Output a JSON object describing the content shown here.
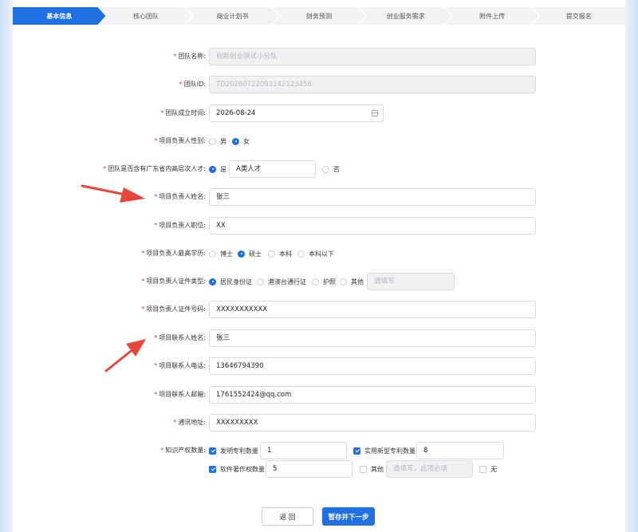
{
  "steps": [
    {
      "label": "基本信息",
      "active": true
    },
    {
      "label": "核心团队",
      "active": false
    },
    {
      "label": "商业计划书",
      "active": false
    },
    {
      "label": "财务预测",
      "active": false
    },
    {
      "label": "创业服务需求",
      "active": false
    },
    {
      "label": "附件上传",
      "active": false
    },
    {
      "label": "提交报名",
      "active": false
    }
  ],
  "required_mark": "*",
  "fields": {
    "team_name": {
      "label": "团队名称:",
      "value": "创新创业测试小分队"
    },
    "team_id": {
      "label": "团队ID:",
      "value": "TD20260722093142123456"
    },
    "founded": {
      "label": "团队成立时间:",
      "value": "2026-08-24"
    },
    "leader_gender": {
      "label": "项目负责人性别:",
      "options": [
        "男",
        "女"
      ],
      "selected": "女"
    },
    "talent": {
      "label": "团队是否含有广东省内高层次人才:",
      "options": [
        "是",
        "否"
      ],
      "selected": "是",
      "detail": "A类人才"
    },
    "leader_name": {
      "label": "项目负责人姓名:",
      "value": "张三"
    },
    "leader_title": {
      "label": "项目负责人职位:",
      "value": "XX"
    },
    "education": {
      "label": "项目负责人最高学历:",
      "options": [
        "博士",
        "硕士",
        "本科",
        "本科以下"
      ],
      "selected": "硕士"
    },
    "id_type": {
      "label": "项目负责人证件类型:",
      "options": [
        "居民身份证",
        "港澳台通行证",
        "护照",
        "其他"
      ],
      "selected": "居民身份证",
      "other_placeholder": "请填写"
    },
    "id_number": {
      "label": "项目负责人证件号码:",
      "value": "XXXXXXXXXXX"
    },
    "contact_name": {
      "label": "项目联系人姓名:",
      "value": "张三"
    },
    "contact_phone": {
      "label": "项目联系人电话:",
      "value": "13646794390"
    },
    "contact_email": {
      "label": "项目联系人邮箱:",
      "value": "1761552424@qq.com"
    },
    "address": {
      "label": "通讯地址:",
      "value": "XXXXXXXXX"
    },
    "ip": {
      "label": "知识产权数量:",
      "invention_label": "发明专利数量",
      "invention_value": "1",
      "invention_checked": true,
      "utility_label": "实用新型专利数量",
      "utility_value": "8",
      "utility_checked": true,
      "software_label": "软件著作权数量",
      "software_value": "5",
      "software_checked": true,
      "other_label": "其他",
      "other_placeholder": "请填写，此项必填",
      "other_checked": false,
      "none_label": "无",
      "none_checked": false
    }
  },
  "buttons": {
    "back": "返 回",
    "next": "暂存并下一步"
  },
  "colors": {
    "primary": "#1f6fe5",
    "required": "#e53935",
    "arrow": "#e8453c"
  }
}
